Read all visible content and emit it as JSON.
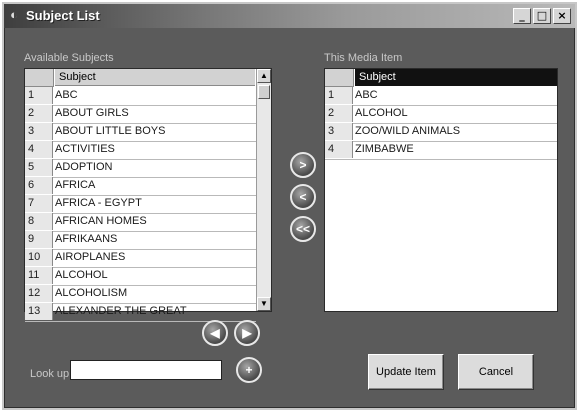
{
  "window": {
    "title": "Subject List"
  },
  "title_buttons": {
    "minimize": "_",
    "maximize": "□",
    "close": "×"
  },
  "available": {
    "label": "Available Subjects",
    "column": "Subject",
    "rows": [
      {
        "n": "1",
        "s": "ABC"
      },
      {
        "n": "2",
        "s": "ABOUT GIRLS"
      },
      {
        "n": "3",
        "s": "ABOUT LITTLE BOYS"
      },
      {
        "n": "4",
        "s": "ACTIVITIES"
      },
      {
        "n": "5",
        "s": "ADOPTION"
      },
      {
        "n": "6",
        "s": "AFRICA"
      },
      {
        "n": "7",
        "s": "AFRICA - EGYPT"
      },
      {
        "n": "8",
        "s": "AFRICAN HOMES"
      },
      {
        "n": "9",
        "s": "AFRIKAANS"
      },
      {
        "n": "10",
        "s": "AIROPLANES"
      },
      {
        "n": "11",
        "s": "ALCOHOL"
      },
      {
        "n": "12",
        "s": "ALCOHOLISM"
      },
      {
        "n": "13",
        "s": "ALEXANDER THE GREAT"
      }
    ]
  },
  "media": {
    "label": "This Media Item",
    "column": "Subject",
    "rows": [
      {
        "n": "1",
        "s": "ABC"
      },
      {
        "n": "2",
        "s": "ALCOHOL"
      },
      {
        "n": "3",
        "s": "ZOO/WILD ANIMALS"
      },
      {
        "n": "4",
        "s": "ZIMBABWE"
      }
    ]
  },
  "transfer": {
    "add": ">",
    "remove": "<",
    "remove_all": "<<"
  },
  "pager": {
    "prev": "◀",
    "next": "▶"
  },
  "lookup": {
    "label": "Look up",
    "value": "",
    "add": "+"
  },
  "buttons": {
    "update": "Update Item",
    "cancel": "Cancel"
  }
}
